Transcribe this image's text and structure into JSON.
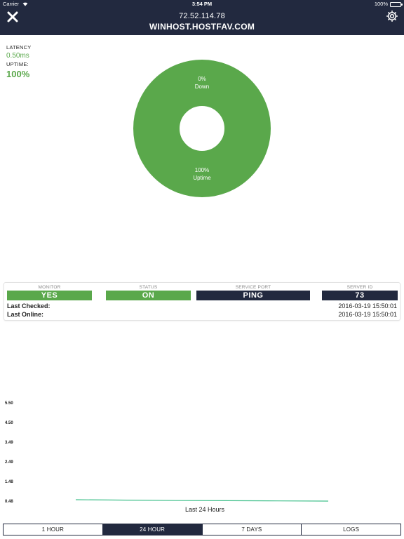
{
  "status_bar": {
    "carrier": "Carrier",
    "time": "3:54 PM",
    "battery": "100%"
  },
  "header": {
    "ip": "72.52.114.78",
    "hostname": "WINHOST.HOSTFAV.COM"
  },
  "stats": {
    "latency_label": "LATENCY",
    "latency_value": "0.50ms",
    "uptime_label": "UPTIME:",
    "uptime_value": "100%"
  },
  "donut": {
    "down_percent": "0%",
    "down_label": "Down",
    "up_percent": "100%",
    "up_label": "Uptime",
    "uptime_fraction": 1.0
  },
  "info": {
    "monitor_label": "MONITOR",
    "monitor_value": "YES",
    "status_label": "STATUS",
    "status_value": "ON",
    "port_label": "SERVICE PORT",
    "port_value": "PING",
    "server_label": "SERVER ID",
    "server_value": "73",
    "last_checked_label": "Last Checked:",
    "last_checked_value": "2016-03-19 15:50:01",
    "last_online_label": "Last Online:",
    "last_online_value": "2016-03-19 15:50:01"
  },
  "chart_data": {
    "type": "line",
    "title": "",
    "xlabel": "Last 24 Hours",
    "ylabel": "",
    "yticks": [
      "5.50",
      "4.50",
      "3.49",
      "2.49",
      "1.48",
      "0.48"
    ],
    "ylim": [
      0.48,
      5.5
    ],
    "series": [
      {
        "values": [
          0.55,
          0.53,
          0.51,
          0.5,
          0.49,
          0.48
        ]
      }
    ]
  },
  "tabs": [
    {
      "label": "1 HOUR",
      "active": false
    },
    {
      "label": "24 HOUR",
      "active": true
    },
    {
      "label": "7 DAYS",
      "active": false
    },
    {
      "label": "LOGS",
      "active": false
    }
  ],
  "colors": {
    "navy": "#22293f",
    "green": "#5aa84b",
    "line": "#3fbf8a"
  }
}
